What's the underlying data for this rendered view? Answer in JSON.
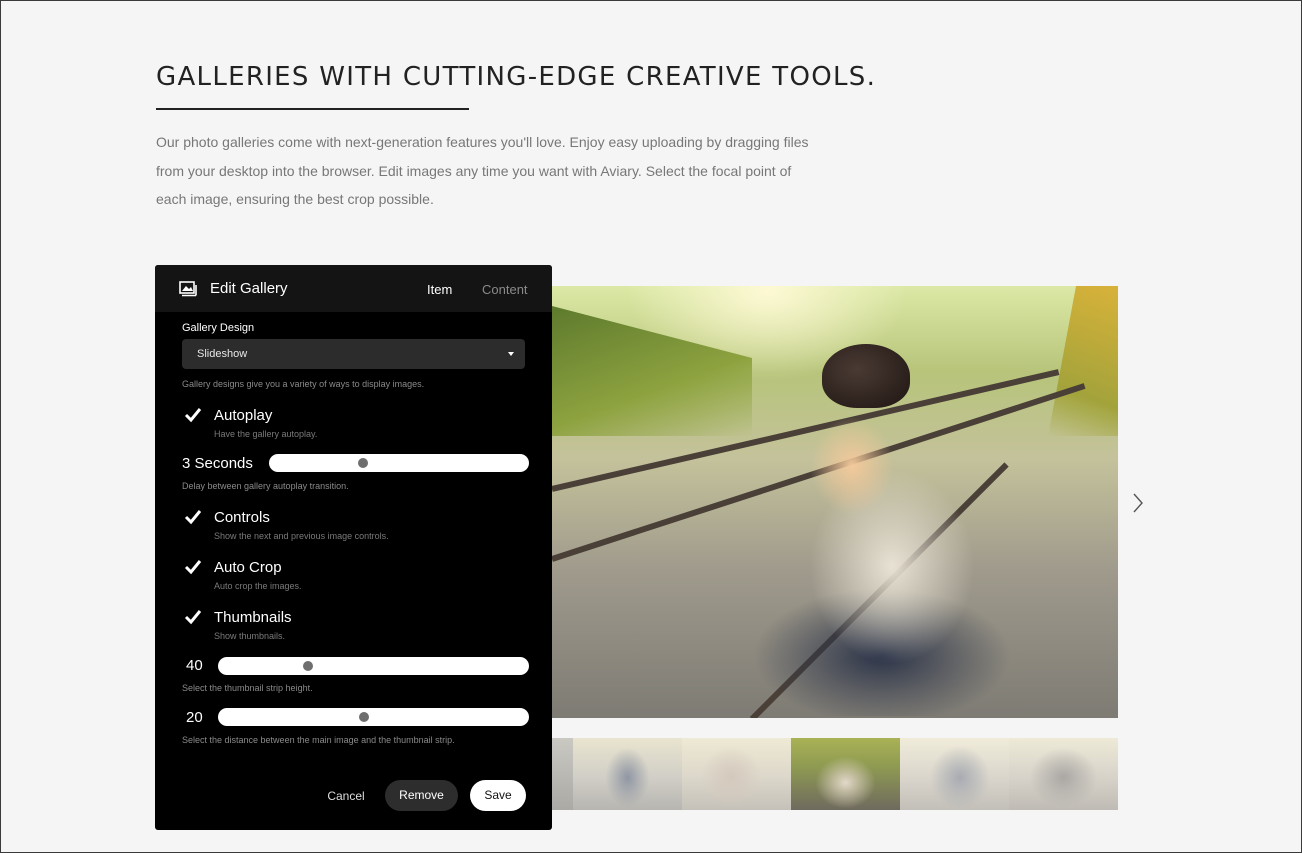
{
  "section": {
    "heading": "GALLERIES WITH CUTTING-EDGE CREATIVE TOOLS.",
    "intro": "Our photo galleries come with next-generation features you'll love. Enjoy easy uploading by dragging files from your desktop into the browser. Edit images any time you want with Aviary. Select the focal point of each image, ensuring the best crop possible."
  },
  "slideshow": {
    "next_icon": "chevron-right-icon",
    "thumbnail_count": 6,
    "active_thumbnail_index": 3
  },
  "panel": {
    "icon": "gallery-icon",
    "title": "Edit Gallery",
    "tabs": [
      {
        "label": "Item",
        "active": true
      },
      {
        "label": "Content",
        "active": false
      }
    ],
    "gallery_design": {
      "label": "Gallery Design",
      "value": "Slideshow",
      "help": "Gallery designs give you a variety of ways to display images."
    },
    "autoplay": {
      "checked": true,
      "title": "Autoplay",
      "description": "Have the gallery autoplay."
    },
    "autoplay_delay": {
      "value_label": "3 Seconds",
      "value_fraction": 0.36,
      "help": "Delay between gallery autoplay transition."
    },
    "controls": {
      "checked": true,
      "title": "Controls",
      "description": "Show the next and previous image controls."
    },
    "auto_crop": {
      "checked": true,
      "title": "Auto Crop",
      "description": "Auto crop the images."
    },
    "thumbnails": {
      "checked": true,
      "title": "Thumbnails",
      "description": "Show thumbnails."
    },
    "thumbnail_height": {
      "value": "40",
      "value_fraction": 0.29,
      "help": "Select the thumbnail strip height."
    },
    "thumbnail_distance": {
      "value": "20",
      "value_fraction": 0.47,
      "help": "Select the distance between the main image and the thumbnail strip."
    },
    "buttons": {
      "cancel": "Cancel",
      "remove": "Remove",
      "save": "Save"
    }
  },
  "colors": {
    "page_background": "#f5f5f5",
    "panel_background": "#000000",
    "heading": "#222222",
    "body_text": "#777777"
  }
}
